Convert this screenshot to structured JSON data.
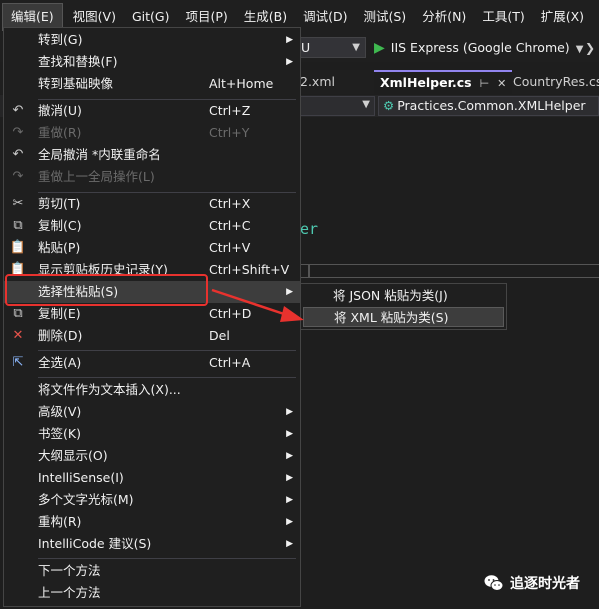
{
  "menubar": {
    "items": [
      "编辑(E)",
      "视图(V)",
      "Git(G)",
      "项目(P)",
      "生成(B)",
      "调试(D)",
      "测试(S)",
      "分析(N)",
      "工具(T)",
      "扩展(X)"
    ]
  },
  "toolbar": {
    "config_value": "U",
    "run_label": "IIS Express (Google Chrome)"
  },
  "tabs": [
    {
      "label": "2.xml"
    },
    {
      "label": "XmlHelper.cs"
    },
    {
      "label": "CountryRes.cs"
    }
  ],
  "navbar": {
    "member_path": "Practices.Common.XMLHelper"
  },
  "editor": {
    "code_fragment": "er"
  },
  "edit_menu": {
    "items": [
      {
        "label": "转到(G)",
        "icon": "none",
        "submenu": true
      },
      {
        "label": "查找和替换(F)",
        "icon": "none",
        "submenu": true
      },
      {
        "label": "转到基础映像",
        "shortcut": "Alt+Home"
      },
      {
        "label": "撤消(U)",
        "shortcut": "Ctrl+Z",
        "icon": "undo-icon"
      },
      {
        "label": "重做(R)",
        "shortcut": "Ctrl+Y",
        "icon": "redo-icon",
        "disabled": true
      },
      {
        "label": "全局撤消 *内联重命名",
        "icon": "undo-icon"
      },
      {
        "label": "重做上一全局操作(L)",
        "icon": "redo-icon",
        "disabled": true
      },
      {
        "label": "剪切(T)",
        "shortcut": "Ctrl+X",
        "icon": "scissors-icon"
      },
      {
        "label": "复制(C)",
        "shortcut": "Ctrl+C",
        "icon": "copy-icon"
      },
      {
        "label": "粘贴(P)",
        "shortcut": "Ctrl+V",
        "icon": "paste-icon"
      },
      {
        "label": "显示剪贴板历史记录(Y)",
        "shortcut": "Ctrl+Shift+V",
        "icon": "clipboard-history-icon"
      },
      {
        "label": "选择性粘贴(S)",
        "submenu": true,
        "selected": true
      },
      {
        "label": "复制(E)",
        "shortcut": "Ctrl+D",
        "icon": "duplicate-icon"
      },
      {
        "label": "删除(D)",
        "shortcut": "Del",
        "icon": "delete-icon"
      },
      {
        "label": "全选(A)",
        "shortcut": "Ctrl+A",
        "icon": "select-all-icon"
      },
      {
        "label": "将文件作为文本插入(X)..."
      },
      {
        "label": "高级(V)",
        "submenu": true
      },
      {
        "label": "书签(K)",
        "submenu": true
      },
      {
        "label": "大纲显示(O)",
        "submenu": true
      },
      {
        "label": "IntelliSense(I)",
        "submenu": true
      },
      {
        "label": "多个文字光标(M)",
        "submenu": true
      },
      {
        "label": "重构(R)",
        "submenu": true
      },
      {
        "label": "IntelliCode 建议(S)",
        "submenu": true
      },
      {
        "label": "下一个方法"
      },
      {
        "label": "上一个方法"
      }
    ]
  },
  "paste_special_menu": {
    "items": [
      {
        "label": "将 JSON 粘贴为类(J)"
      },
      {
        "label": "将 XML 粘贴为类(S)",
        "selected": true
      }
    ]
  },
  "watermark": {
    "text": "追逐时光者"
  },
  "colors": {
    "menu_bg": "#1f1f1f",
    "selection_bg": "#3d3d3d",
    "annotation_red": "#e8322e",
    "run_green": "#3fb950",
    "class_teal": "#4ec9b0",
    "tab_accent": "#9184ee"
  }
}
